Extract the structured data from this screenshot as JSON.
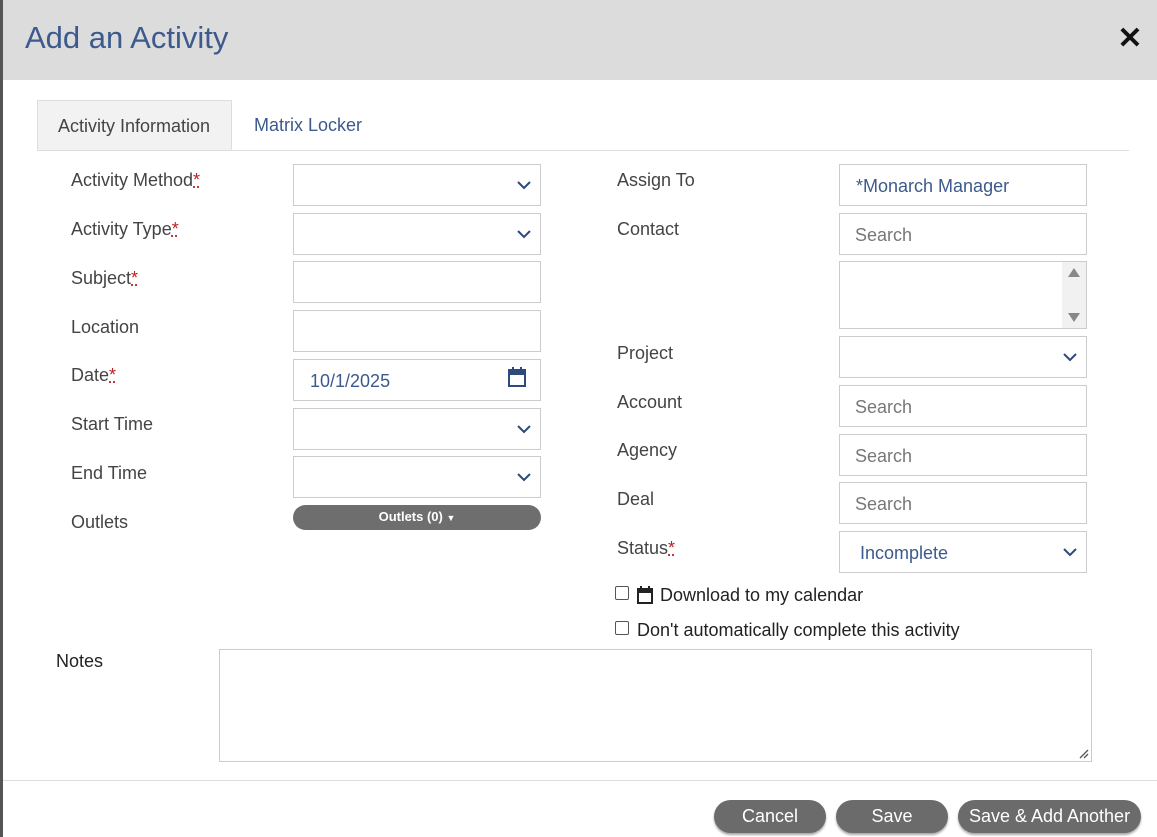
{
  "dialog": {
    "title": "Add an Activity"
  },
  "tabs": [
    {
      "label": "Activity Information"
    },
    {
      "label": "Matrix Locker"
    }
  ],
  "left": {
    "activity_method": {
      "label": "Activity Method",
      "value": ""
    },
    "activity_type": {
      "label": "Activity Type",
      "value": ""
    },
    "subject": {
      "label": "Subject",
      "value": ""
    },
    "location": {
      "label": "Location",
      "value": ""
    },
    "date": {
      "label": "Date",
      "value": "10/1/2025"
    },
    "start_time": {
      "label": "Start Time",
      "value": ""
    },
    "end_time": {
      "label": "End Time",
      "value": ""
    },
    "outlets": {
      "label": "Outlets",
      "button": "Outlets (0)"
    },
    "required_mark": "*"
  },
  "right": {
    "assign_to": {
      "label": "Assign To",
      "value": "*Monarch Manager"
    },
    "contact": {
      "label": "Contact",
      "placeholder": "Search"
    },
    "project": {
      "label": "Project",
      "value": ""
    },
    "account": {
      "label": "Account",
      "placeholder": "Search"
    },
    "agency": {
      "label": "Agency",
      "placeholder": "Search"
    },
    "deal": {
      "label": "Deal",
      "placeholder": "Search"
    },
    "status": {
      "label": "Status",
      "value": "Incomplete"
    },
    "download_calendar": {
      "label": "Download to my calendar",
      "checked": false
    },
    "dont_complete": {
      "label": "Don't automatically complete this activity",
      "checked": false
    }
  },
  "notes": {
    "label": "Notes",
    "value": ""
  },
  "footer": {
    "cancel": "Cancel",
    "save": "Save",
    "save_add": "Save & Add Another"
  },
  "colors": {
    "header_bg": "#dcdcdc",
    "title": "#3c5a8c",
    "button_bg": "#6b6b6b",
    "required": "#b22222"
  }
}
